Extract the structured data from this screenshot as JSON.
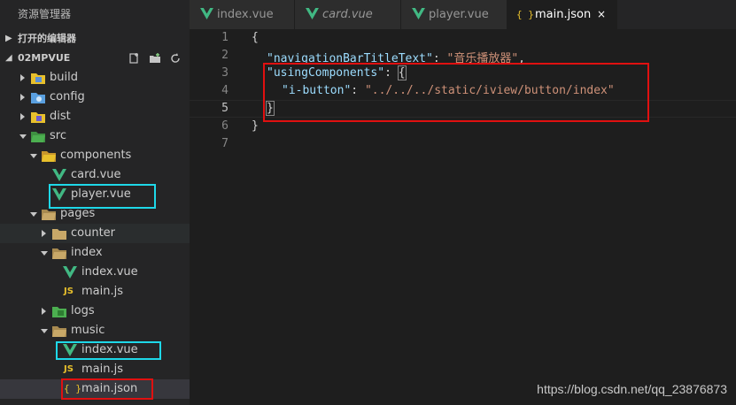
{
  "sidebar": {
    "title": "资源管理器",
    "open_editors_label": "打开的编辑器",
    "project_label": "02MPVUE",
    "items": [
      {
        "label": "build",
        "kind": "folder-closed",
        "color": "#e8c02c"
      },
      {
        "label": "config",
        "kind": "folder-closed",
        "color": "#5aa0e0"
      },
      {
        "label": "dist",
        "kind": "folder-closed",
        "color": "#e8c02c"
      },
      {
        "label": "src",
        "kind": "folder-open",
        "color": "#4caf50"
      },
      {
        "label": "components",
        "kind": "folder-open",
        "color": "#e8c02c"
      },
      {
        "label": "card.vue",
        "kind": "vue"
      },
      {
        "label": "player.vue",
        "kind": "vue"
      },
      {
        "label": "pages",
        "kind": "folder-open",
        "color": "#c8a868"
      },
      {
        "label": "counter",
        "kind": "folder-closed",
        "color": "#c8a868"
      },
      {
        "label": "index",
        "kind": "folder-open",
        "color": "#c8a868"
      },
      {
        "label": "index.vue",
        "kind": "vue"
      },
      {
        "label": "main.js",
        "kind": "js"
      },
      {
        "label": "logs",
        "kind": "folder-closed",
        "color": "#4caf50"
      },
      {
        "label": "music",
        "kind": "folder-open",
        "color": "#c8a868"
      },
      {
        "label": "index.vue",
        "kind": "vue"
      },
      {
        "label": "main.js",
        "kind": "js"
      },
      {
        "label": "main.json",
        "kind": "json"
      }
    ],
    "js_badge": "JS",
    "json_badge": "{ }"
  },
  "tabs": [
    {
      "label": "index.vue",
      "icon": "vue-icon",
      "italic": false,
      "active": false
    },
    {
      "label": "card.vue",
      "icon": "vue-icon",
      "italic": true,
      "active": false
    },
    {
      "label": "player.vue",
      "icon": "vue-icon",
      "italic": false,
      "active": false
    },
    {
      "label": "main.json",
      "icon": "json-icon",
      "italic": false,
      "active": true
    }
  ],
  "tab_close": "×",
  "tab_json_badge": "{ }",
  "editor": {
    "line_numbers": [
      "1",
      "2",
      "3",
      "4",
      "5",
      "6",
      "7"
    ],
    "current_line": "5",
    "tokens": {
      "l1_open": "{",
      "key_title": "\"navigationBarTitleText\"",
      "colon_sp": ": ",
      "val_title": "\"音乐播放器\"",
      "comma": ",",
      "key_using": "\"usingComponents\"",
      "brace_open": "{",
      "key_ibutton": "\"i-button\"",
      "val_ibutton": "\"../../../static/iview/button/index\"",
      "brace_close": "}",
      "l6_close": "}"
    }
  },
  "watermark": "https://blog.csdn.net/qq_23876873",
  "colors": {
    "highlight_cyan": "#1ed8e8",
    "highlight_red": "#e01010",
    "vue_green": "#41b883",
    "json_key": "#9cdcfe",
    "json_string": "#ce9178"
  }
}
